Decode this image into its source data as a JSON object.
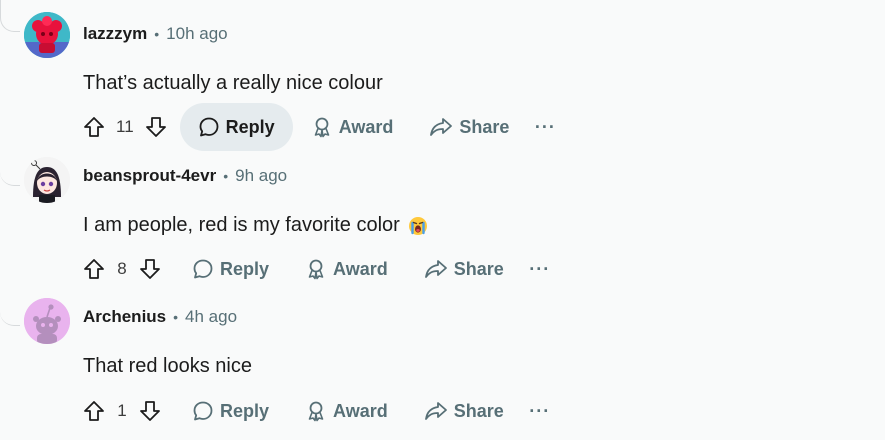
{
  "comments": [
    {
      "author": "lazzzym",
      "time": "10h ago",
      "text": "That’s actually a really nice colour",
      "votes": "11",
      "avatar_icon": "snoo-red-avatar",
      "reply_active": true
    },
    {
      "author": "beansprout-4evr",
      "time": "9h ago",
      "text": "I am people, red is my favorite color",
      "emoji": "crying-face-emoji",
      "votes": "8",
      "avatar_icon": "anime-character-avatar"
    },
    {
      "author": "Archenius",
      "time": "4h ago",
      "text": "That red looks nice",
      "votes": "1",
      "avatar_icon": "default-snoo-avatar"
    }
  ],
  "actions": {
    "reply": "Reply",
    "award": "Award",
    "share": "Share",
    "more": "···"
  },
  "colors": {
    "background": "#f9fafa",
    "meta": "#576f76",
    "active_pill": "#e5ebee",
    "thread_line": "#d7dadc"
  }
}
